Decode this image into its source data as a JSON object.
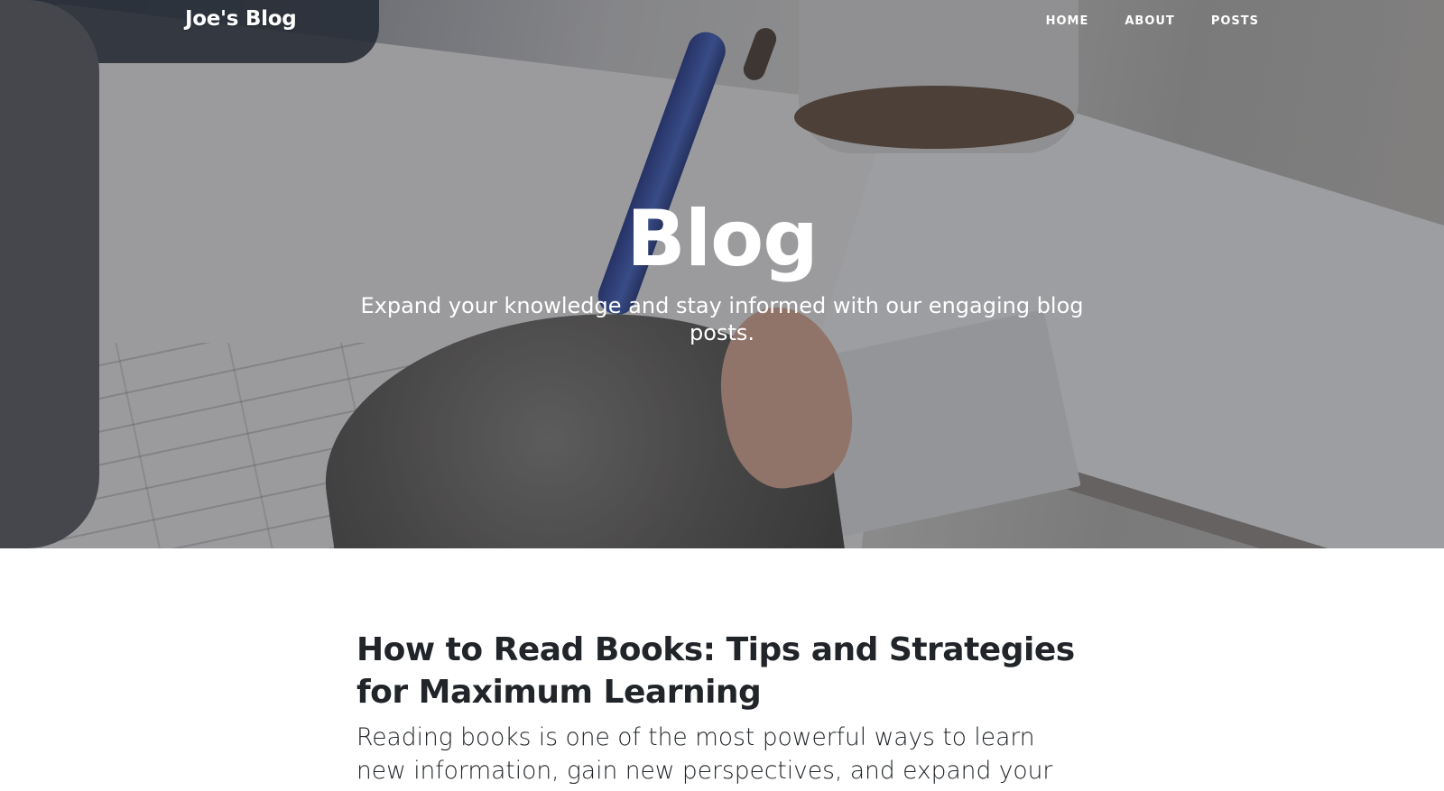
{
  "brand": {
    "name": "Joe's Blog"
  },
  "nav": {
    "items": [
      {
        "label": "HOME"
      },
      {
        "label": "ABOUT"
      },
      {
        "label": "POSTS"
      }
    ]
  },
  "hero": {
    "title": "Blog",
    "subtitle": "Expand your knowledge and stay informed with our engaging blog posts."
  },
  "posts": [
    {
      "title": "How to Read Books: Tips and Strategies for Maximum Learning",
      "excerpt": "Reading books is one of the most powerful ways to learn new information, gain new perspectives, and expand your"
    }
  ],
  "colors": {
    "text_dark": "#212529",
    "hero_text": "#ffffff",
    "page_background": "#ffffff"
  }
}
